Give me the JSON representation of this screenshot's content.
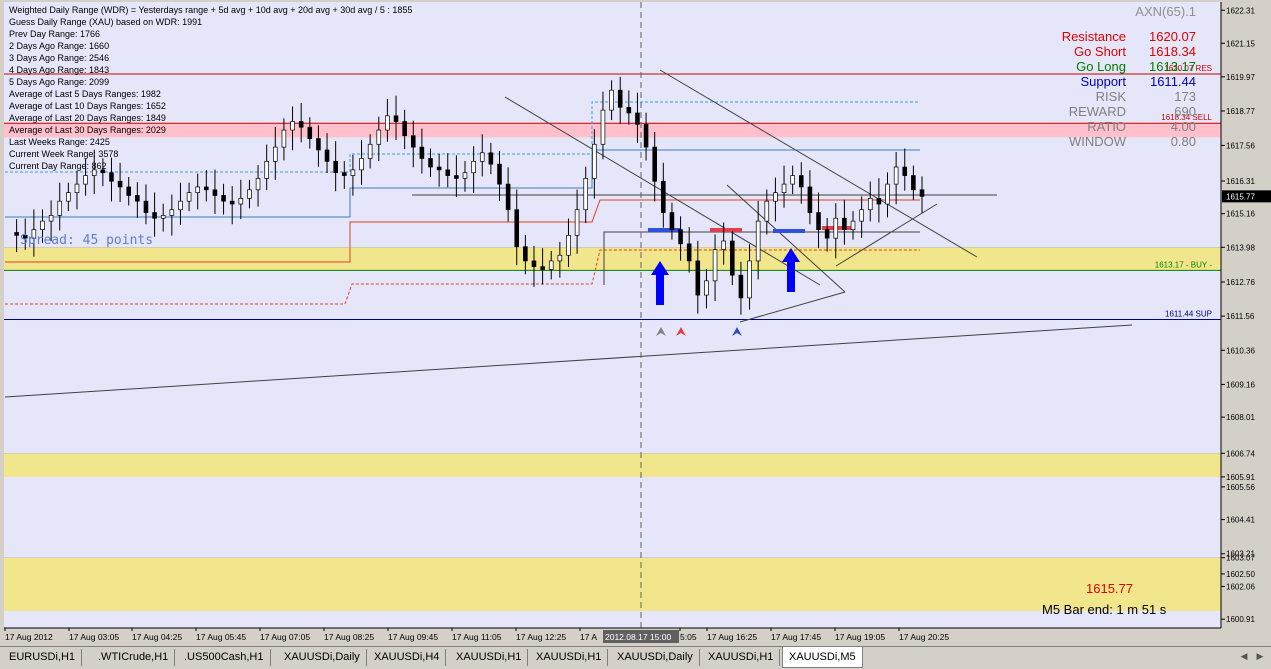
{
  "info": [
    "Weighted Daily Range (WDR) = Yesterdays range + 5d avg + 10d avg + 20d avg + 30d avg / 5 : 1855",
    "Guess Daily Range (XAU) based on WDR: 1991",
    "Prev Day Range: 1766",
    "2 Days Ago Range: 1660",
    "3 Days Ago Range: 2546",
    "4 Days Ago Range: 1843",
    "5 Days Ago Range: 2099",
    "Average of Last 5 Days Ranges: 1982",
    "Average of Last 10 Days Ranges: 1652",
    "Average of Last 20 Days Ranges: 1849",
    "Average of Last 30 Days Ranges: 2029",
    "Last Weeks Range: 2425",
    "Current Week Range: 3578",
    "Current Day Range: 862"
  ],
  "right_panel": {
    "header": "AXN(65).1",
    "rows": [
      {
        "label": "Resistance",
        "value": "1620.07",
        "color": "#e00000"
      },
      {
        "label": "Go Short",
        "value": "1618.34",
        "color": "#e00000"
      },
      {
        "label": "Go Long",
        "value": "1613.17",
        "color": "#008000"
      },
      {
        "label": "Support",
        "value": "1611.44",
        "color": "#0000c8"
      },
      {
        "label": "RISK",
        "value": "173",
        "color": "#808080"
      },
      {
        "label": "REWARD",
        "value": "690",
        "color": "#808080"
      },
      {
        "label": "RATIO",
        "value": "4.00",
        "color": "#808080"
      },
      {
        "label": "WINDOW",
        "value": "0.80",
        "color": "#808080"
      }
    ]
  },
  "spread_text": "Spread: 45 points",
  "current_price_text": "1615.77",
  "bar_end_text": "M5 Bar end: 1 m 51 s",
  "level_labels": {
    "res": "1620.07 RES",
    "sell": "1618.34 SELL",
    "buy": "1613.17 - BUY -",
    "sup": "1611.44 SUP"
  },
  "chart_data": {
    "type": "candlestick",
    "symbol": "XAUUSDi",
    "timeframe": "M5",
    "ylim": [
      1600.6,
      1622.6
    ],
    "y_ticks": [
      "1622.31",
      "1621.15",
      "1619.97",
      "1618.77",
      "1617.56",
      "1616.31",
      "1615.16",
      "1613.98",
      "1612.76",
      "1611.56",
      "1610.36",
      "1609.16",
      "1608.01",
      "1606.74",
      "1605.91",
      "1605.56",
      "1604.41",
      "1603.21",
      "1603.07",
      "1602.50",
      "1602.06",
      "1600.91"
    ],
    "current_price": "1615.77",
    "x_ticks": [
      "17 Aug 2012",
      "17 Aug 03:05",
      "17 Aug 04:25",
      "17 Aug 05:45",
      "17 Aug 07:05",
      "17 Aug 08:25",
      "17 Aug 09:45",
      "17 Aug 11:05",
      "17 Aug 12:25",
      "17 A",
      "2012.08.17 15:00",
      "5:05",
      "17 Aug 16:25",
      "17 Aug 17:45",
      "17 Aug 19:05",
      "17 Aug 20:25"
    ],
    "levels": {
      "resistance": 1620.07,
      "go_short": 1618.34,
      "go_long": 1613.17,
      "support": 1611.44
    },
    "zones": [
      {
        "from": 1617.84,
        "to": 1618.34,
        "color": "#ffc0cb"
      },
      {
        "from": 1613.17,
        "to": 1613.98,
        "color": "#f2e68c"
      },
      {
        "from": 1605.91,
        "to": 1606.74,
        "color": "#f2e68c"
      },
      {
        "from": 1601.2,
        "to": 1603.07,
        "color": "#f2e68c"
      }
    ],
    "close_path": [
      1614.5,
      1614.4,
      1614.3,
      1614.6,
      1614.9,
      1615.1,
      1615.6,
      1615.9,
      1616.2,
      1616.5,
      1616.7,
      1616.6,
      1616.3,
      1616.1,
      1615.8,
      1615.6,
      1615.2,
      1615.0,
      1615.1,
      1615.3,
      1615.6,
      1615.9,
      1616.1,
      1616.0,
      1615.8,
      1615.6,
      1615.5,
      1615.7,
      1616.0,
      1616.4,
      1617.0,
      1617.5,
      1618.1,
      1618.4,
      1618.2,
      1617.8,
      1617.4,
      1617.0,
      1616.6,
      1616.5,
      1616.7,
      1617.1,
      1617.6,
      1618.1,
      1618.6,
      1618.4,
      1617.9,
      1617.5,
      1617.1,
      1616.8,
      1616.7,
      1616.5,
      1616.4,
      1616.6,
      1617.0,
      1617.3,
      1616.9,
      1616.2,
      1615.3,
      1614.0,
      1613.5,
      1613.3,
      1613.2,
      1613.5,
      1613.7,
      1614.4,
      1615.3,
      1616.4,
      1617.6,
      1618.8,
      1619.5,
      1618.9,
      1618.7,
      1618.3,
      1617.5,
      1616.3,
      1615.2,
      1614.6,
      1614.1,
      1613.5,
      1612.3,
      1612.8,
      1613.9,
      1614.2,
      1613.0,
      1612.2,
      1613.5,
      1614.9,
      1615.6,
      1615.9,
      1616.2,
      1616.5,
      1616.1,
      1615.2,
      1614.6,
      1614.3,
      1615.0,
      1614.6,
      1614.9,
      1615.3,
      1615.7,
      1615.5,
      1616.2,
      1616.8,
      1616.5,
      1616.0,
      1615.77
    ]
  },
  "tabs": [
    "EURUSDi,H1",
    ".WTICrude,H1",
    ".US500Cash,H1",
    "XAUUSDi,Daily",
    "XAUUSDi,H4",
    "XAUUSDi,H1",
    "XAUUSDi,H1",
    "XAUUSDi,Daily",
    "XAUUSDi,H1",
    "XAUUSDi,M5"
  ],
  "active_tab": 9
}
